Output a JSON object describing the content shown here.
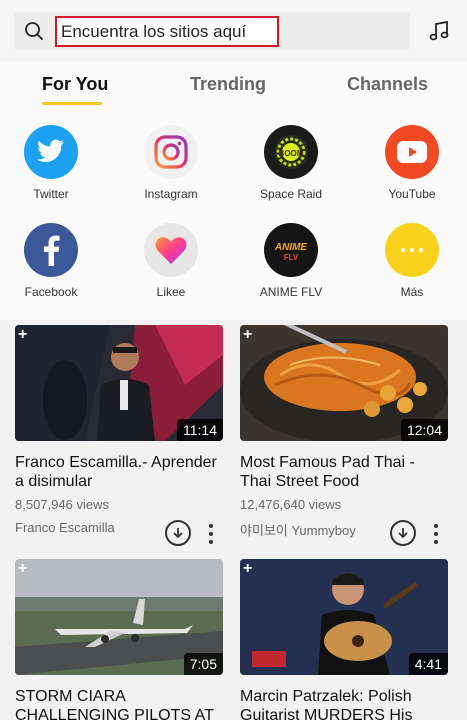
{
  "search": {
    "value": "Encuentra los sitios aquí"
  },
  "icons": {
    "search": "search-icon",
    "music": "music-note-icon"
  },
  "tabs": [
    {
      "label": "For You",
      "active": true
    },
    {
      "label": "Trending",
      "active": false
    },
    {
      "label": "Channels",
      "active": false
    }
  ],
  "shortcuts": [
    {
      "label": "Twitter",
      "icon": "twitter-icon",
      "color": "#1da1f2"
    },
    {
      "label": "Instagram",
      "icon": "instagram-icon",
      "color": "#f1f1f1"
    },
    {
      "label": "Space Raid",
      "icon": "space-raid-icon",
      "color": "#1a1a1a"
    },
    {
      "label": "YouTube",
      "icon": "youtube-icon",
      "color": "#f04a23"
    },
    {
      "label": "Facebook",
      "icon": "facebook-icon",
      "color": "#3b5998"
    },
    {
      "label": "Likee",
      "icon": "likee-icon",
      "color": "#e7e7e7"
    },
    {
      "label": "ANIME FLV",
      "icon": "anime-flv-icon",
      "color": "#151515"
    },
    {
      "label": "Más",
      "icon": "more-dots-icon",
      "color": "#f8d21c"
    }
  ],
  "videos": [
    {
      "duration": "11:14",
      "title": "Franco Escamilla.- Aprender a disimular",
      "views": "8,507,946 views",
      "channel": "Franco Escamilla"
    },
    {
      "duration": "12:04",
      "title": "Most Famous Pad Thai - Thai Street Food",
      "views": "12,476,640 views",
      "channel": "야미보이 Yummyboy"
    },
    {
      "duration": "7:05",
      "title": "STORM CIARA CHALLENGING PILOTS AT",
      "views": "",
      "channel": ""
    },
    {
      "duration": "4:41",
      "title": "Marcin Patrzalek: Polish Guitarist MURDERS His",
      "views": "",
      "channel": ""
    }
  ],
  "colors": {
    "accent": "#f5c518",
    "search_border": "#d3192a"
  }
}
